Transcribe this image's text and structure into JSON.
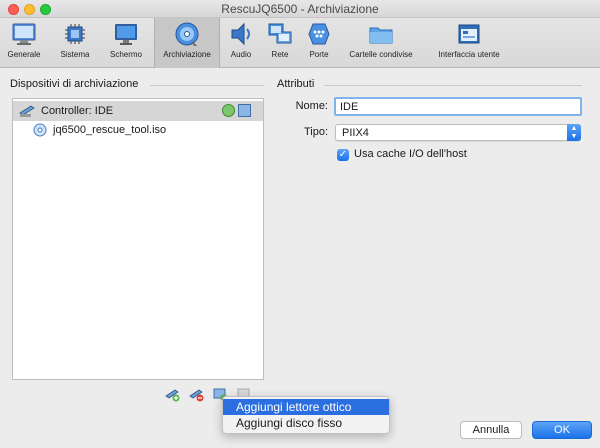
{
  "window": {
    "title": "RescuJQ6500 - Archiviazione"
  },
  "toolbar": {
    "items": [
      {
        "label": "Generale",
        "icon": "general-monitor-icon"
      },
      {
        "label": "Sistema",
        "icon": "chip-icon"
      },
      {
        "label": "Schermo",
        "icon": "display-icon"
      },
      {
        "label": "Archiviazione",
        "icon": "storage-disk-icon",
        "selected": true
      },
      {
        "label": "Audio",
        "icon": "speaker-icon"
      },
      {
        "label": "Rete",
        "icon": "network-icon"
      },
      {
        "label": "Porte",
        "icon": "port-icon"
      },
      {
        "label": "Cartelle condivise",
        "icon": "folder-icon"
      },
      {
        "label": "Interfaccia utente",
        "icon": "ui-window-icon"
      }
    ]
  },
  "left": {
    "title": "Dispositivi di archiviazione",
    "controller": "Controller: IDE",
    "child": "jq6500_rescue_tool.iso"
  },
  "right": {
    "title": "Attributi",
    "name_label": "Nome:",
    "name_value": "IDE",
    "type_label": "Tipo:",
    "type_value": "PIIX4",
    "cache_label": "Usa cache I/O dell'host",
    "cache_checked": true
  },
  "menu": {
    "items": [
      "Aggiungi lettore ottico",
      "Aggiungi disco fisso"
    ],
    "highlighted": 0
  },
  "buttons": {
    "cancel": "Annulla",
    "ok": "OK"
  },
  "colors": {
    "accent": "#1b72e8",
    "selected_row": "#d6d6d6",
    "menu_highlight": "#2a6ee0"
  }
}
